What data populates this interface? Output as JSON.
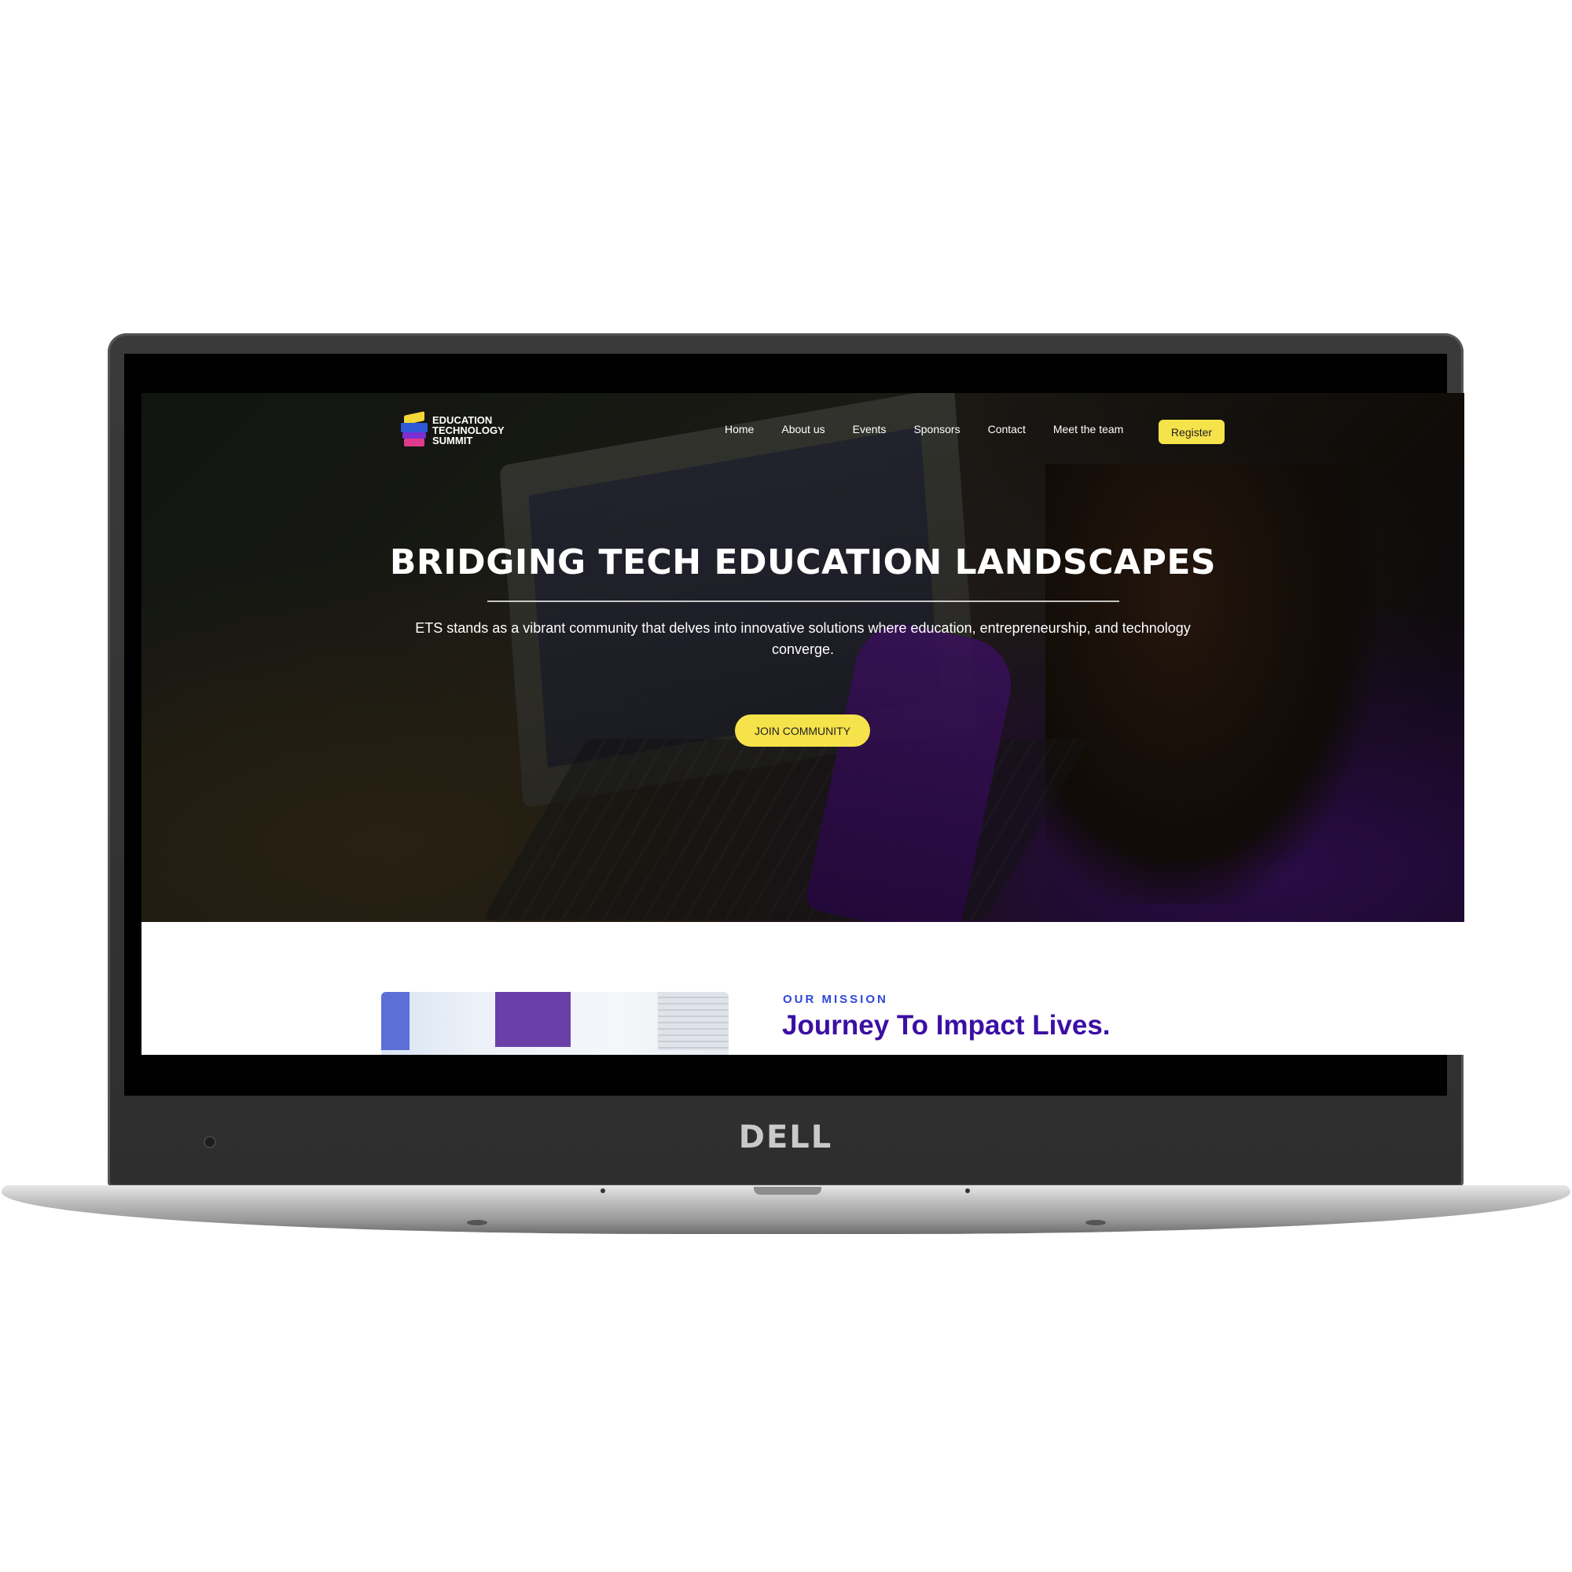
{
  "device": {
    "brand": "DELL"
  },
  "nav": {
    "logo": {
      "line1": "EDUCATION",
      "line2": "TECHNOLOGY",
      "line3": "SUMMIT"
    },
    "links": [
      "Home",
      "About us",
      "Events",
      "Sponsors",
      "Contact",
      "Meet the team"
    ],
    "register_label": "Register"
  },
  "hero": {
    "title": "BRIDGING TECH EDUCATION LANDSCAPES",
    "subtitle": "ETS stands as a vibrant community that delves into innovative solutions where education, entrepreneurship, and technology converge.",
    "cta_label": "JOIN COMMUNITY"
  },
  "mission": {
    "eyebrow": "OUR MISSION",
    "title": "Journey To Impact Lives."
  },
  "colors": {
    "accent_yellow": "#f6e24b",
    "mission_eyebrow_blue": "#2f47d8",
    "mission_title_purple": "#3b0fa3"
  }
}
